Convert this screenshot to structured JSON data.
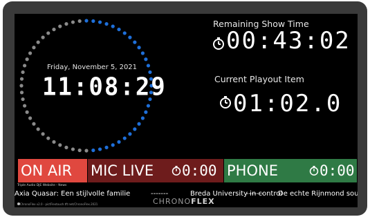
{
  "clock": {
    "date": "Friday, November 5, 2021",
    "time": "11:08:29",
    "seconds_elapsed": 29,
    "dot_colors": {
      "elapsed": "#1e6fd9",
      "remaining": "#8a8a8a"
    }
  },
  "remaining_show_time": {
    "label": "Remaining Show Time",
    "value": "00:43:02"
  },
  "current_playout_item": {
    "label": "Current Playout Item",
    "value": "01:02.0"
  },
  "status_tiles": [
    {
      "label": "ON AIR",
      "color": "#e0483f"
    },
    {
      "label": "MIC LIVE",
      "timer": "0:00",
      "color": "#6e1c1c"
    },
    {
      "label": "PHONE",
      "timer": "0:00",
      "color": "#2f7a45"
    }
  ],
  "source_line": "Triple Audio DJE Website - News",
  "ticker": {
    "item1": "Axia Quasar: Een stijlvolle familie",
    "sep1": "-------",
    "item2": "Breda University in control",
    "sep2": "-------",
    "item3": "De echte Rijnmond sound"
  },
  "footer_text": "ChronoFlex v2.0 - pictFlextouch.tft:net/ChronoFlex.2021",
  "logo": {
    "part1": "CHRONO",
    "part2": "FLEX"
  },
  "icons": {
    "timer": "stopwatch-icon"
  }
}
